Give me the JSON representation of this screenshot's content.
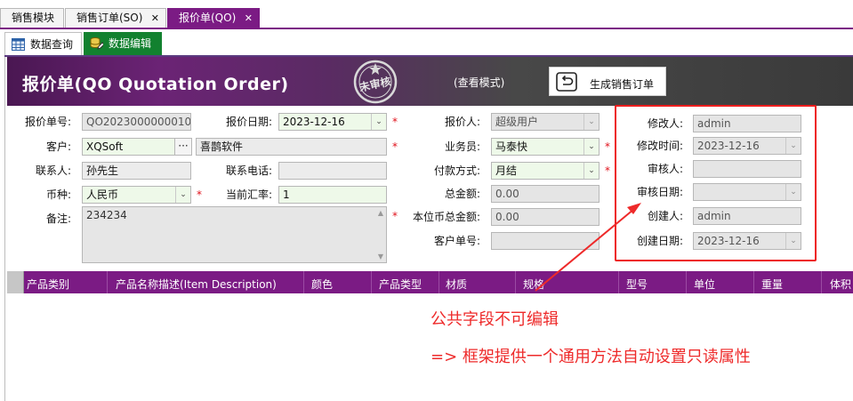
{
  "top_tabs": [
    {
      "label": "销售模块",
      "closable": false,
      "active": false
    },
    {
      "label": "销售订单(SO)",
      "closable": true,
      "active": false
    },
    {
      "label": "报价单(QO)",
      "closable": true,
      "active": true
    }
  ],
  "close_glyph": "✕",
  "sub_tabs": [
    {
      "label": "数据查询",
      "icon": "table-grid-icon",
      "active": false
    },
    {
      "label": "数据编辑",
      "icon": "database-edit-icon",
      "active": true
    }
  ],
  "header": {
    "title": "报价单(QO Quotation Order)",
    "stamp_text": "未审核",
    "mode": "(查看模式)",
    "generate_button": "生成销售订单",
    "generate_icon": "undo-return-icon"
  },
  "form": {
    "quote_no": {
      "label": "报价单号:",
      "value": "QO2023000000010"
    },
    "quote_date": {
      "label": "报价日期:",
      "value": "2023-12-16"
    },
    "quoter": {
      "label": "报价人:",
      "value": "超级用户"
    },
    "customer": {
      "label": "客户:",
      "code": "XQSoft",
      "name": "喜鹊软件",
      "lookup": "···"
    },
    "salesman": {
      "label": "业务员:",
      "value": "马泰快"
    },
    "contact": {
      "label": "联系人:",
      "value": "孙先生"
    },
    "phone": {
      "label": "联系电话:",
      "value": ""
    },
    "payment": {
      "label": "付款方式:",
      "value": "月结"
    },
    "currency": {
      "label": "币种:",
      "value": "人民币"
    },
    "rate": {
      "label": "当前汇率:",
      "value": "1"
    },
    "total": {
      "label": "总金额:",
      "value": "0.00"
    },
    "remark": {
      "label": "备注:",
      "value": "234234"
    },
    "local_total": {
      "label": "本位币总金额:",
      "value": "0.00"
    },
    "customer_order": {
      "label": "客户单号:",
      "value": ""
    },
    "modifier": {
      "label": "修改人:",
      "value": "admin"
    },
    "modify_time": {
      "label": "修改时间:",
      "value": "2023-12-16"
    },
    "auditor": {
      "label": "审核人:",
      "value": ""
    },
    "audit_date": {
      "label": "审核日期:",
      "value": ""
    },
    "creator": {
      "label": "创建人:",
      "value": "admin"
    },
    "create_date": {
      "label": "创建日期:",
      "value": "2023-12-16"
    },
    "required_mark": "*",
    "dropdown_glyph": "⌄"
  },
  "grid": {
    "columns": [
      "产品类别",
      "产品名称描述(Item Description)",
      "颜色",
      "产品类型",
      "材质",
      "规格",
      "型号",
      "单位",
      "重量",
      "体积"
    ],
    "rows": []
  },
  "annotations": {
    "line1": "公共字段不可编辑",
    "line2": "=>  框架提供一个通用方法自动设置只读属性"
  },
  "colors": {
    "accent_purple": "#7b1b84",
    "active_green": "#12812f",
    "annotation_red": "#ee2a2a",
    "required_bg": "#eef9e9",
    "readonly_bg": "#e5e5e5"
  }
}
